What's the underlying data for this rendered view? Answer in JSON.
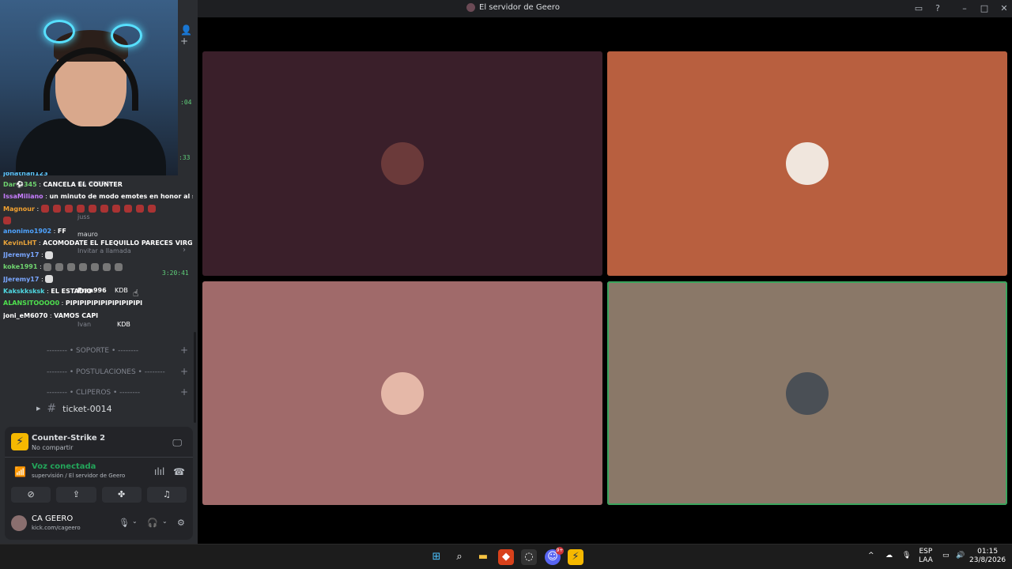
{
  "window": {
    "title": "El servidor de Geero"
  },
  "timestamps": {
    "t1": ":04",
    "t2": ":33",
    "t3": "3:20:41"
  },
  "chat": [
    {
      "user": "jonathan123",
      "color": "#5fc8ff",
      "message": ""
    },
    {
      "user": "Dar⚽345",
      "color": "#6fd36f",
      "message": "CANCELA EL COUNTER"
    },
    {
      "user": "IssaMiliano",
      "color": "#c77dff",
      "message": "un minuto de modo emotes en honor al sold"
    },
    {
      "user": "Magnour",
      "color": "#f0a030",
      "message": "",
      "emotes": 11
    },
    {
      "user": "anonimo1902",
      "color": "#4ea3ff",
      "message": "FF"
    },
    {
      "user": "KevinLHT",
      "color": "#e8a33a",
      "message": "ACOMODATE EL FLEQUILLO PARECES VIRGO"
    },
    {
      "user": "JJeremy17",
      "color": "#7aa7ff",
      "message": "",
      "emotes": 1
    },
    {
      "user": "koke1991",
      "color": "#6fd36f",
      "message": "",
      "emotes": 7
    },
    {
      "user": "JJeremy17",
      "color": "#7aa7ff",
      "message": "",
      "emotes": 1
    },
    {
      "user": "Kakskksksk",
      "color": "#4fd6e0",
      "message": "EL ESTADIO"
    },
    {
      "user": "ALANSITOOOO0",
      "color": "#4ee04e",
      "message": "PIPIPIPIPIPIPIPIPIPIPI"
    },
    {
      "user": "joni_eM6070",
      "color": "#ffffff",
      "message": "VAMOS CAPI"
    }
  ],
  "voice_members": [
    {
      "name": "CA GEERO"
    },
    {
      "name": "juss"
    },
    {
      "name": "mauro"
    },
    {
      "name": "Invitar a llamada"
    },
    {
      "name": "Fran996",
      "tag": "KDB"
    },
    {
      "name": "Ivan",
      "tag": "KDB"
    }
  ],
  "channels": [
    {
      "label": "-------- • SOPORTE • --------"
    },
    {
      "label": "-------- • POSTULACIONES • --------"
    },
    {
      "label": "-------- • CLIPEROS • --------"
    }
  ],
  "ticket": {
    "label": "ticket-0014"
  },
  "activity": {
    "game": "Counter-Strike 2",
    "sub": "No compartir"
  },
  "voice": {
    "status": "Voz conectada",
    "location": "supervisión / El servidor de Geero"
  },
  "user": {
    "name": "CA GEERO",
    "status": "kick.com/cageero"
  },
  "tiles": [
    {
      "bg": "#3a1f2a",
      "avatar": "#6b3a3a"
    },
    {
      "bg": "#b85f3f",
      "avatar": "#f0e6dd"
    },
    {
      "bg": "#a06a6a",
      "avatar": "#e5b8a8"
    },
    {
      "bg": "#8a7868",
      "avatar": "#4a4f55",
      "speaking": true
    }
  ],
  "taskbar": {
    "lang_top": "ESP",
    "lang_bottom": "LAA",
    "time": "01:15",
    "date": "23/8/2026",
    "discord_badge": "9+"
  },
  "icons": [
    "add-friend-icon",
    "hash-icon",
    "stream-icon",
    "signal-icon",
    "soundwave-icon",
    "hangup-icon",
    "camera-off-icon",
    "screen-share-icon",
    "activities-icon",
    "soundboard-icon",
    "mic-icon",
    "headphones-icon",
    "gear-icon"
  ]
}
